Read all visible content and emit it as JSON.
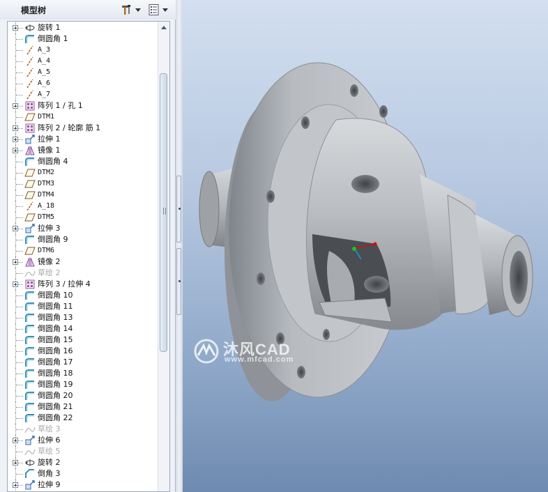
{
  "panel": {
    "title": "模型树"
  },
  "tree": [
    {
      "label": "旋转 1",
      "icon": "revolve-icon",
      "expandable": true
    },
    {
      "label": "倒圆角 1",
      "icon": "round-icon",
      "expandable": false
    },
    {
      "label": "A_3",
      "icon": "axis-icon",
      "expandable": false,
      "mono": true
    },
    {
      "label": "A_4",
      "icon": "axis-icon",
      "expandable": false,
      "mono": true
    },
    {
      "label": "A_5",
      "icon": "axis-icon",
      "expandable": false,
      "mono": true
    },
    {
      "label": "A_6",
      "icon": "axis-icon",
      "expandable": false,
      "mono": true
    },
    {
      "label": "A_7",
      "icon": "axis-icon",
      "expandable": false,
      "mono": true
    },
    {
      "label": "阵列 1 / 孔 1",
      "icon": "pattern-icon",
      "expandable": true
    },
    {
      "label": "DTM1",
      "icon": "datum-plane-icon",
      "expandable": false,
      "mono": true
    },
    {
      "label": "阵列 2 / 轮廓 筋 1",
      "icon": "pattern-icon",
      "expandable": true
    },
    {
      "label": "拉伸 1",
      "icon": "extrude-icon",
      "expandable": true
    },
    {
      "label": "镜像 1",
      "icon": "mirror-icon",
      "expandable": true
    },
    {
      "label": "倒圆角 4",
      "icon": "round-icon",
      "expandable": false
    },
    {
      "label": "DTM2",
      "icon": "datum-plane-icon",
      "expandable": false,
      "mono": true
    },
    {
      "label": "DTM3",
      "icon": "datum-plane-icon",
      "expandable": false,
      "mono": true
    },
    {
      "label": "DTM4",
      "icon": "datum-plane-icon",
      "expandable": false,
      "mono": true
    },
    {
      "label": "A_18",
      "icon": "axis-icon",
      "expandable": false,
      "mono": true
    },
    {
      "label": "DTM5",
      "icon": "datum-plane-icon",
      "expandable": false,
      "mono": true
    },
    {
      "label": "拉伸 3",
      "icon": "extrude-icon",
      "expandable": true
    },
    {
      "label": "倒圆角 9",
      "icon": "round-icon",
      "expandable": false
    },
    {
      "label": "DTM6",
      "icon": "datum-plane-icon",
      "expandable": false,
      "mono": true
    },
    {
      "label": "镜像 2",
      "icon": "mirror-icon",
      "expandable": true
    },
    {
      "label": "草绘 2",
      "icon": "sketch-icon",
      "expandable": false,
      "suppressed": true
    },
    {
      "label": "阵列 3 / 拉伸 4",
      "icon": "pattern-icon",
      "expandable": true
    },
    {
      "label": "倒圆角 10",
      "icon": "round-icon",
      "expandable": false
    },
    {
      "label": "倒圆角 11",
      "icon": "round-icon",
      "expandable": false
    },
    {
      "label": "倒圆角 13",
      "icon": "round-icon",
      "expandable": false
    },
    {
      "label": "倒圆角 14",
      "icon": "round-icon",
      "expandable": false
    },
    {
      "label": "倒圆角 15",
      "icon": "round-icon",
      "expandable": false
    },
    {
      "label": "倒圆角 16",
      "icon": "round-icon",
      "expandable": false
    },
    {
      "label": "倒圆角 17",
      "icon": "round-icon",
      "expandable": false
    },
    {
      "label": "倒圆角 18",
      "icon": "round-icon",
      "expandable": false
    },
    {
      "label": "倒圆角 19",
      "icon": "round-icon",
      "expandable": false
    },
    {
      "label": "倒圆角 20",
      "icon": "round-icon",
      "expandable": false
    },
    {
      "label": "倒圆角 21",
      "icon": "round-icon",
      "expandable": false
    },
    {
      "label": "倒圆角 22",
      "icon": "round-icon",
      "expandable": false
    },
    {
      "label": "草绘 3",
      "icon": "sketch-icon",
      "expandable": false,
      "suppressed": true
    },
    {
      "label": "拉伸 6",
      "icon": "extrude-icon",
      "expandable": true
    },
    {
      "label": "草绘 5",
      "icon": "sketch-icon",
      "expandable": false,
      "suppressed": true
    },
    {
      "label": "旋转 2",
      "icon": "revolve-icon",
      "expandable": true
    },
    {
      "label": "倒角 3",
      "icon": "chamfer-icon",
      "expandable": false
    },
    {
      "label": "拉伸 9",
      "icon": "extrude-icon",
      "expandable": true
    }
  ],
  "watermark": {
    "brand": "沐风CAD",
    "url": "www.mfcad.com"
  },
  "colors": {
    "tree_lines": "#8a8a8a",
    "viewport_top": "#d3dff0",
    "viewport_bottom": "#6f8ab0",
    "part_gray": "#a9adb3"
  }
}
